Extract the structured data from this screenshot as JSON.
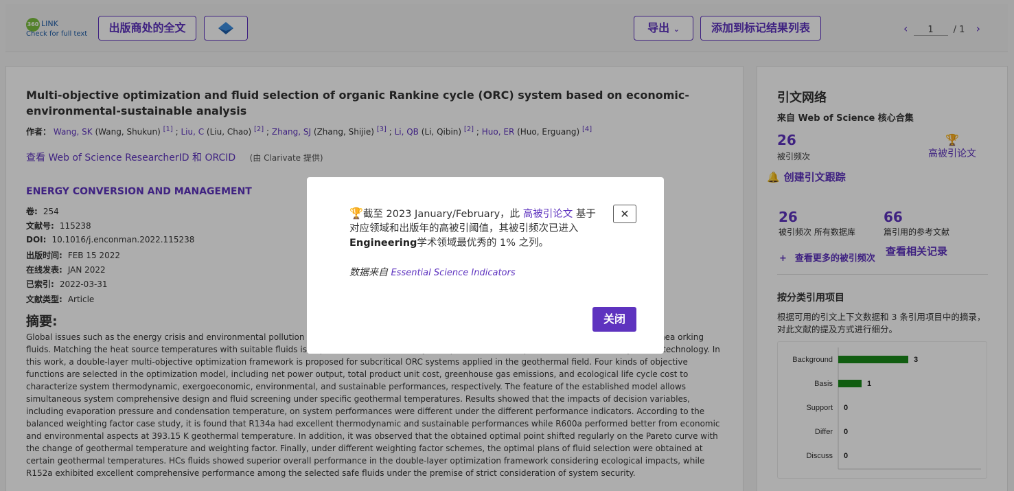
{
  "topbar": {
    "logo_badge": "360",
    "logo_link": "LINK",
    "logo_caption": "Check for full text",
    "publisher_fulltext": "出版商处的全文",
    "export": "导出",
    "add_to_marked": "添加到标记结果列表",
    "page_current": "1",
    "page_total": "/ 1"
  },
  "record": {
    "title": "Multi-objective optimization and fluid selection of organic Rankine cycle (ORC) system based on economic-environmental-sustainable analysis",
    "authors_label": "作者：",
    "authors": [
      {
        "short": "Wang, SK",
        "full": "(Wang, Shukun)",
        "ref": "[1]"
      },
      {
        "short": "Liu, C",
        "full": "(Liu, Chao)",
        "ref": "[2]"
      },
      {
        "short": "Zhang, SJ",
        "full": "(Zhang, Shijie)",
        "ref": "[3]"
      },
      {
        "short": "Li, QB",
        "full": "(Li, Qibin)",
        "ref": "[2]"
      },
      {
        "short": "Huo, ER",
        "full": "(Huo, Erguang)",
        "ref": "[4]"
      }
    ],
    "researcher_id_link": "查看 Web of Science ResearcherID 和 ORCID",
    "researcher_id_by": "(由 Clarivate 提供)",
    "journal": "ENERGY CONVERSION AND MANAGEMENT",
    "meta": [
      {
        "k": "卷:",
        "v": "254"
      },
      {
        "k": "文献号:",
        "v": "115238"
      },
      {
        "k": "DOI:",
        "v": "10.1016/j.enconman.2022.115238"
      },
      {
        "k": "出版时间:",
        "v": "FEB 15 2022"
      },
      {
        "k": "在线发表:",
        "v": "JAN 2022"
      },
      {
        "k": "已索引:",
        "v": "2022-03-31"
      },
      {
        "k": "文献类型:",
        "v": "Article"
      }
    ],
    "abstract_heading": "摘要:",
    "abstract": "Global issues such as the energy crisis and environmental pollution im systems are a promising solution to utilize renewable energies and recover waste hea orking fluids. Matching the heat source temperatures with suitable fluids is important to enhance the system performance and promote the marketability of this technology. In this work, a double-layer multi-objective optimization framework is proposed for subcritical ORC systems applied in the geothermal field. Four kinds of objective functions are selected in the optimization model, including net power output, total product unit cost, greenhouse gas emissions, and ecological life cycle cost to characterize system thermodynamic, exergoeconomic, environmental, and sustainable performances, respectively. The feature of the established model allows simultaneous system comprehensive design and fluid screening under specific geothermal temperatures. Results showed that the impacts of decision variables, including evaporation pressure and condensation temperature, on system performances were different under the different performance indicators. According to the balanced weighting factor case study, it is found that R134a had excellent thermodynamic and sustainable performances while R600a performed better from economic and environmental aspects at 393.15 K geothermal temperature. In addition, it was observed that the obtained optimal point shifted regularly on the Pareto curve with the change of geothermal temperature and weighting factor. Finally, under different weighting factor schemes, the optimal plans of fluid selection were obtained at certain geothermal temperatures. HCs fluids showed superior overall performance in the double-layer optimization framework considering ecological impacts, while R152a exhibited excellent comprehensive performance among the selected safe fluids under the premise of strict consideration of system security."
  },
  "sidebar": {
    "heading": "引文网络",
    "source": "来自 Web of Science 核心合集",
    "times_cited": "26",
    "times_cited_label": "被引频次",
    "highly_cited": "高被引论文",
    "create_alert": "创建引文跟踪",
    "all_db_count": "26",
    "all_db_label": "被引频次 所有数据库",
    "refs_count": "66",
    "refs_label": "篇引用的参考文献",
    "more_cited": "查看更多的被引频次",
    "related": "查看相关记录",
    "cat_heading": "按分类引用项目",
    "cat_desc": "根据可用的引文上下文数据和 3 条引用项目中的摘录，对此文献的提及方式进行细分。"
  },
  "chart_data": {
    "type": "bar",
    "orientation": "horizontal",
    "categories": [
      "Background",
      "Basis",
      "Support",
      "Differ",
      "Discuss"
    ],
    "values": [
      3,
      1,
      0,
      0,
      0
    ],
    "color": "#1a8a1a"
  },
  "modal": {
    "msg_pre": "截至 2023 January/February，此 ",
    "msg_link": "高被引论文",
    "msg_mid": " 基于对应领域和出版年的高被引阈值，其被引频次已进入",
    "msg_field": "Engineering",
    "msg_post": "学术领域最优秀的 1% 之列。",
    "source_label": "数据来自 ",
    "source_link": "Essential Science Indicators",
    "close_x": "✕",
    "close_button": "关闭"
  },
  "colors": {
    "accent": "#5e33bf",
    "trophy": "#b5241b",
    "bar": "#1a8a1a"
  }
}
